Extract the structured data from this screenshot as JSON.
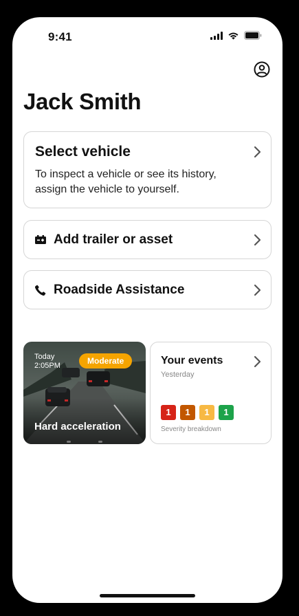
{
  "status_bar": {
    "time": "9:41"
  },
  "header": {
    "user_name": "Jack Smith",
    "profile_icon": "profile-icon"
  },
  "select_vehicle": {
    "title": "Select vehicle",
    "description": "To inspect a vehicle or see its history, assign the vehicle to yourself."
  },
  "actions": [
    {
      "label": "Add trailer or asset",
      "icon": "trailer-icon"
    },
    {
      "label": "Roadside Assistance",
      "icon": "phone-icon"
    }
  ],
  "event_tile": {
    "day": "Today",
    "time": "2:05PM",
    "badge": "Moderate",
    "badge_color": "#F5A400",
    "label": "Hard acceleration"
  },
  "events_card": {
    "title": "Your events",
    "subtitle": "Yesterday",
    "severity": [
      {
        "value": "1",
        "color": "#D62418"
      },
      {
        "value": "1",
        "color": "#C25700"
      },
      {
        "value": "1",
        "color": "#F7B944"
      },
      {
        "value": "1",
        "color": "#1DA34A"
      }
    ],
    "severity_label": "Severity breakdown"
  }
}
